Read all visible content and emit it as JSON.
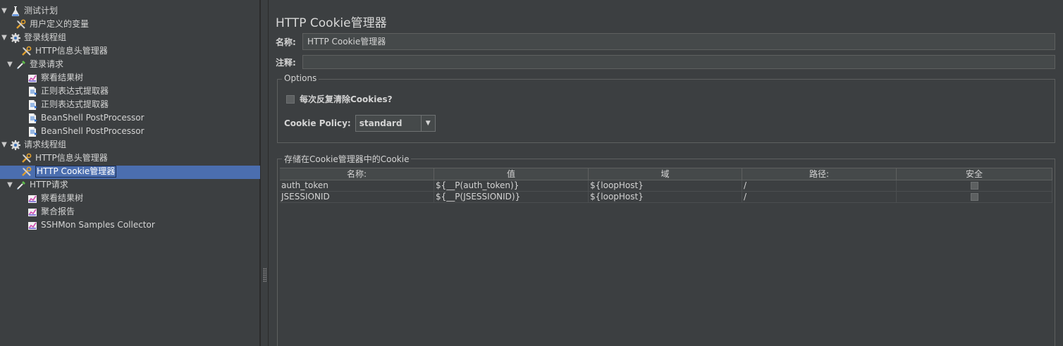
{
  "tree": {
    "nodes": [
      {
        "label": "测试计划",
        "icon": "flask-icon",
        "depth": 0,
        "toggle": "▼"
      },
      {
        "label": "用户定义的变量",
        "icon": "wrench-icon",
        "depth": 1,
        "toggle": ""
      },
      {
        "label": "登录线程组",
        "icon": "gear-icon",
        "depth": 0,
        "toggle": "▼"
      },
      {
        "label": "HTTP信息头管理器",
        "icon": "wrench-icon",
        "depth": 2,
        "toggle": ""
      },
      {
        "label": "登录请求",
        "icon": "pipette-icon",
        "depth": 1,
        "toggle": "▼"
      },
      {
        "label": "察看结果树",
        "icon": "chart-icon",
        "depth": 3,
        "toggle": ""
      },
      {
        "label": "正则表达式提取器",
        "icon": "document-icon",
        "depth": 3,
        "toggle": ""
      },
      {
        "label": "正则表达式提取器",
        "icon": "document-icon",
        "depth": 3,
        "toggle": ""
      },
      {
        "label": "BeanShell PostProcessor",
        "icon": "document-icon",
        "depth": 3,
        "toggle": ""
      },
      {
        "label": "BeanShell PostProcessor",
        "icon": "document-icon",
        "depth": 3,
        "toggle": ""
      },
      {
        "label": "请求线程组",
        "icon": "gear-icon",
        "depth": 0,
        "toggle": "▼"
      },
      {
        "label": "HTTP信息头管理器",
        "icon": "wrench-icon",
        "depth": 2,
        "toggle": ""
      },
      {
        "label": "HTTP Cookie管理器",
        "icon": "wrench-icon",
        "depth": 2,
        "toggle": "",
        "selected": true
      },
      {
        "label": "HTTP请求",
        "icon": "pipette-icon",
        "depth": 1,
        "toggle": "▼"
      },
      {
        "label": "察看结果树",
        "icon": "chart-icon",
        "depth": 3,
        "toggle": ""
      },
      {
        "label": "聚合报告",
        "icon": "chart-icon",
        "depth": 3,
        "toggle": ""
      },
      {
        "label": "SSHMon Samples Collector",
        "icon": "chart-icon",
        "depth": 3,
        "toggle": ""
      }
    ]
  },
  "panel": {
    "title": "HTTP Cookie管理器",
    "name_label": "名称:",
    "name_value": "HTTP Cookie管理器",
    "comment_label": "注释:",
    "comment_value": "",
    "options": {
      "title": "Options",
      "clear_each_iteration_label": "每次反复清除Cookies?",
      "clear_each_iteration_checked": false,
      "policy_label": "Cookie Policy:",
      "policy_value": "standard"
    },
    "cookies": {
      "title": "存储在Cookie管理器中的Cookie",
      "columns": [
        "名称:",
        "值",
        "域",
        "路径:",
        "安全"
      ],
      "rows": [
        {
          "name": "auth_token",
          "value": "${__P(auth_token)}",
          "domain": "${loopHost}",
          "path": "/",
          "secure": false
        },
        {
          "name": "JSESSIONID",
          "value": "${__P(JSESSIONID)}",
          "domain": "${loopHost}",
          "path": "/",
          "secure": false
        }
      ]
    }
  },
  "colors": {
    "background": "#3c3f41",
    "selection": "#4b6eaf",
    "text": "#d4d4d4"
  }
}
